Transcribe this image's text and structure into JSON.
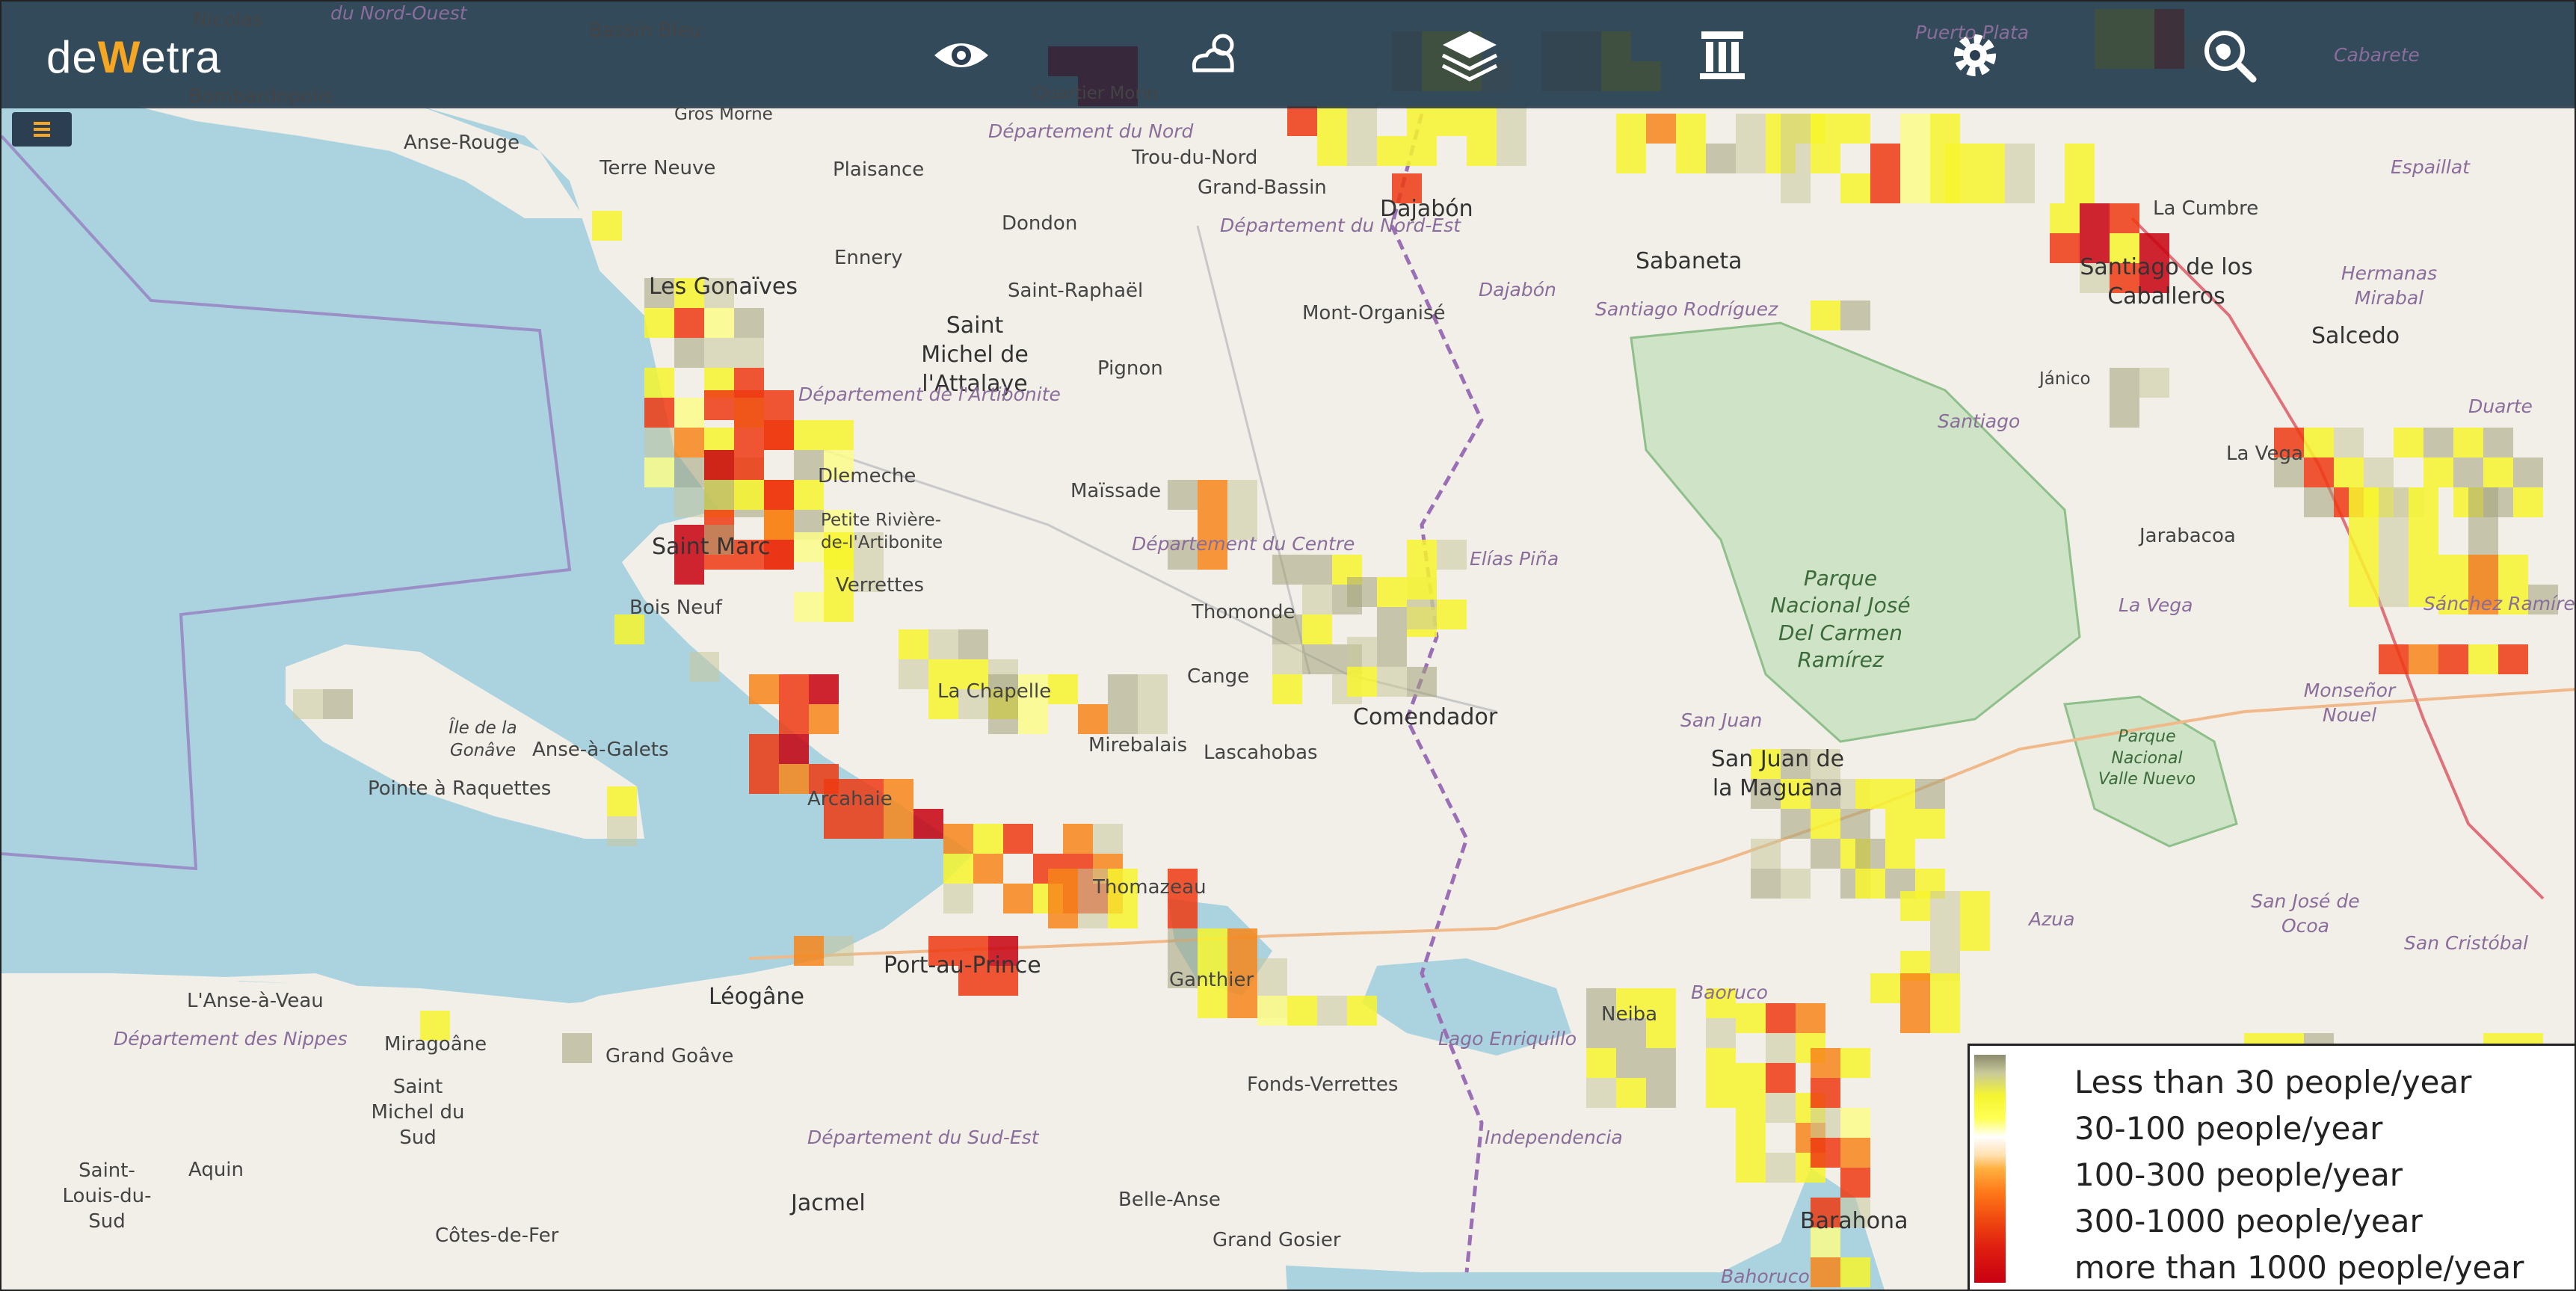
{
  "app": {
    "logo_prefix": "de",
    "logo_accent": "W",
    "logo_suffix": "etra"
  },
  "toolbar": {
    "icons": [
      "eye-icon",
      "weather-icon",
      "layers-icon",
      "column-icon",
      "gear-icon",
      "globe-search-icon"
    ]
  },
  "colors": {
    "topbar": "#182c3e",
    "accent": "#f5a623",
    "sea": "#aad3df",
    "land": "#f2efe9"
  },
  "map": {
    "places": {
      "nicolas": "Nicolas",
      "nord_ouest": "du Nord-Ouest",
      "bassin_bleu": "Bassin Bleu",
      "bombardopolis": "Bombardopolis",
      "gros_morne": "Gros Morne",
      "anse_rouge": "Anse-Rouge",
      "terre_neuve": "Terre Neuve",
      "plaisance": "Plaisance",
      "quartier_morin": "Quartier Morin",
      "trou_du_nord": "Trou-du-Nord",
      "grand_bassin": "Grand-Bassin",
      "dajabon": "Dajabón",
      "dondon": "Dondon",
      "ennery": "Ennery",
      "les_gonaives": "Les Gonaïves",
      "saint_raphael": "Saint-Raphaël",
      "mont_organise": "Mont-Organisé",
      "sabaneta": "Sabaneta",
      "la_cumbre": "La Cumbre",
      "santiago_caballeros": "Santiago de los Caballeros",
      "salcedo": "Salcedo",
      "saint_michel_attalaye": "Saint Michel de l'Attalaye",
      "pignon": "Pignon",
      "janico": "Jánico",
      "santiago": "Santiago",
      "la_vega_city": "La Vega",
      "duarte": "Duarte",
      "maissade": "Maïssade",
      "dlemeche": "Dlemeche",
      "petite_riviere": "Petite Rivière-de-l'Artibonite",
      "saint_marc": "Saint Marc",
      "jarabacoa": "Jarabacoa",
      "verrettes": "Verrettes",
      "bois_neuf": "Bois Neuf",
      "thomonde": "Thomonde",
      "elias_pina": "Elías Piña",
      "la_vega": "La Vega",
      "la_chapelle": "La Chapelle",
      "cange": "Cange",
      "comendador": "Comendador",
      "ile_gonave": "Île de la Gonâve",
      "anse_a_galets": "Anse-à-Galets",
      "mirebalais": "Mirebalais",
      "lascahobas": "Lascahobas",
      "san_juan": "San Juan",
      "san_juan_maguana": "San Juan de la Maguana",
      "monsenor_nouel": "Monseñor Nouel",
      "pointe_raquettes": "Pointe à Raquettes",
      "arcahaie": "Arcahaie",
      "thomazeau": "Thomazeau",
      "port_au_prince": "Port-au-Prince",
      "ganthier": "Ganthier",
      "azua": "Azua",
      "san_jose_ocoa": "San José de Ocoa",
      "san_cristobal": "San Cristóbal",
      "anse_a_veau": "L'Anse-à-Veau",
      "leogane": "Léogâne",
      "miragoane": "Miragoâne",
      "grand_goave": "Grand Goâve",
      "neiba": "Neiba",
      "baoruco": "Baoruco",
      "lago_enriquillo": "Lago Enriquillo",
      "saint_michel_sud": "Saint Michel du Sud",
      "fonds_verrettes": "Fonds-Verrettes",
      "independencia": "Independencia",
      "saint_louis_sud": "Saint-Louis-du-Sud",
      "aquin": "Aquin",
      "jacmel": "Jacmel",
      "belle_anse": "Belle-Anse",
      "barahona": "Barahona",
      "cotes_de_fer": "Côtes-de-Fer",
      "grand_gosier": "Grand Gosier",
      "bahoruco": "Bahoruco",
      "espaillat": "Espaillat",
      "hermanas_mirabal": "Hermanas Mirabal",
      "santiago_rodriguez": "Santiago Rodríguez",
      "dajabon_prov": "Dajabón",
      "sanchez_ramirez": "Sánchez Ramírez",
      "pito": "Puerto Plata",
      "cabarete": "Cabarete"
    },
    "departments": {
      "nord": "Département du Nord",
      "nord_est": "Département du Nord-Est",
      "artibonite": "Département de l'Artibonite",
      "centre": "Département du Centre",
      "nippes": "Département des Nippes",
      "sud_est": "Département du Sud-Est"
    },
    "parks": {
      "carmen_ramirez": "Parque Nacional José Del Carmen Ramírez",
      "valle_nuevo": "Parque Nacional Valle Nuevo"
    }
  },
  "legend": {
    "items": [
      "Less than 30 people/year",
      "30-100 people/year",
      "100-300 people/year",
      "300-1000 people/year",
      "more than 1000 people/year"
    ]
  }
}
